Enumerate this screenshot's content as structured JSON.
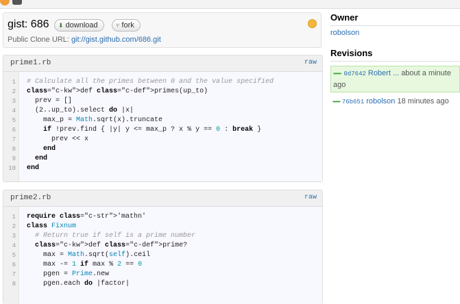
{
  "header": {
    "title": "gist: 686",
    "download_label": "download",
    "fork_label": "fork",
    "clone_label": "Public Clone URL:",
    "clone_url": "git://gist.github.com/686.git"
  },
  "files": [
    {
      "name": "prime1.rb",
      "raw_label": "raw"
    },
    {
      "name": "prime2.rb",
      "raw_label": "raw"
    }
  ],
  "sidebar": {
    "owner_heading": "Owner",
    "owner": "robolson",
    "revisions_heading": "Revisions",
    "revisions": [
      {
        "dots": "••••••·",
        "hash": "0d7642",
        "author": "Robert ...",
        "time": "about a minute ago"
      },
      {
        "dots": "••••••",
        "hash": "76b651",
        "author": "robolson",
        "time": "18 minutes ago"
      }
    ]
  },
  "code1": [
    "# Calculate all the primes between 0 and the value specified",
    "def primes(up_to)",
    "  prev = []",
    "  (2..up_to).select do |x|",
    "    max_p = Math.sqrt(x).truncate",
    "    if !prev.find { |y| y <= max_p ? x % y == 0 : break }",
    "      prev << x",
    "    end",
    "  end",
    "end"
  ],
  "code2": [
    "require 'mathn'",
    "class Fixnum",
    "  # Return true if self is a prime number",
    "  def prime?",
    "    max = Math.sqrt(self).ceil",
    "    max -= 1 if max % 2 == 0",
    "    pgen = Prime.new",
    "    pgen.each do |factor|"
  ]
}
